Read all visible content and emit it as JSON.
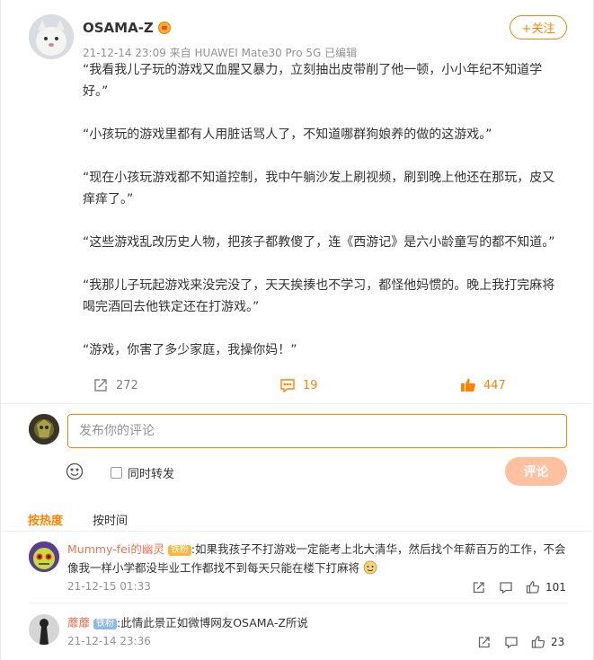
{
  "post": {
    "author": "OSAMA-Z",
    "meta": "21-12-14 23:09  来自 HUAWEI Mate30 Pro 5G  已编辑",
    "follow_label": "+关注",
    "paragraphs": [
      "“我看我儿子玩的游戏又血腥又暴力，立刻抽出皮带削了他一顿，小小年纪不知道学好。”",
      "“小孩玩的游戏里都有人用脏话骂人了，不知道哪群狗娘养的做的这游戏。”",
      "“现在小孩玩游戏都不知道控制，我中午躺沙发上刷视频，刷到晚上他还在那玩，皮又痒痒了。”",
      "“这些游戏乱改历史人物，把孩子都教傻了，连《西游记》是六小龄童写的都不知道。”",
      "“我那儿子玩起游戏来没完没了，天天挨揍也不学习，都怪他妈惯的。晚上我打完麻将喝完酒回去他铁定还在打游戏。”",
      "“游戏，你害了多少家庭，我操你妈！”"
    ],
    "share_count": "272",
    "comment_count": "19",
    "like_count": "447"
  },
  "composer": {
    "placeholder": "发布你的评论",
    "repost_label": "同时转发",
    "submit_label": "评论"
  },
  "tabs": {
    "hot": "按热度",
    "time": "按时间"
  },
  "comments": [
    {
      "user": "Mummy-fei的幽灵",
      "badge": "铁粉",
      "text": ":如果我孩子不打游戏一定能考上北大清华，然后找个年薪百万的工作，不会像我一样小学都没毕业工作都找不到每天只能在楼下打麻将",
      "time": "21-12-15 01:33",
      "likes": "101"
    },
    {
      "user": "蘼蘼",
      "badge": "铁粉",
      "text": ":此情此景正如微博网友OSAMA-Z所说",
      "time": "21-12-14 23:36",
      "likes": "23"
    }
  ],
  "colors": {
    "accent": "#ff8200",
    "username": "#eb7350",
    "meta": "#939393",
    "submit_disabled": "#ffc09f"
  }
}
